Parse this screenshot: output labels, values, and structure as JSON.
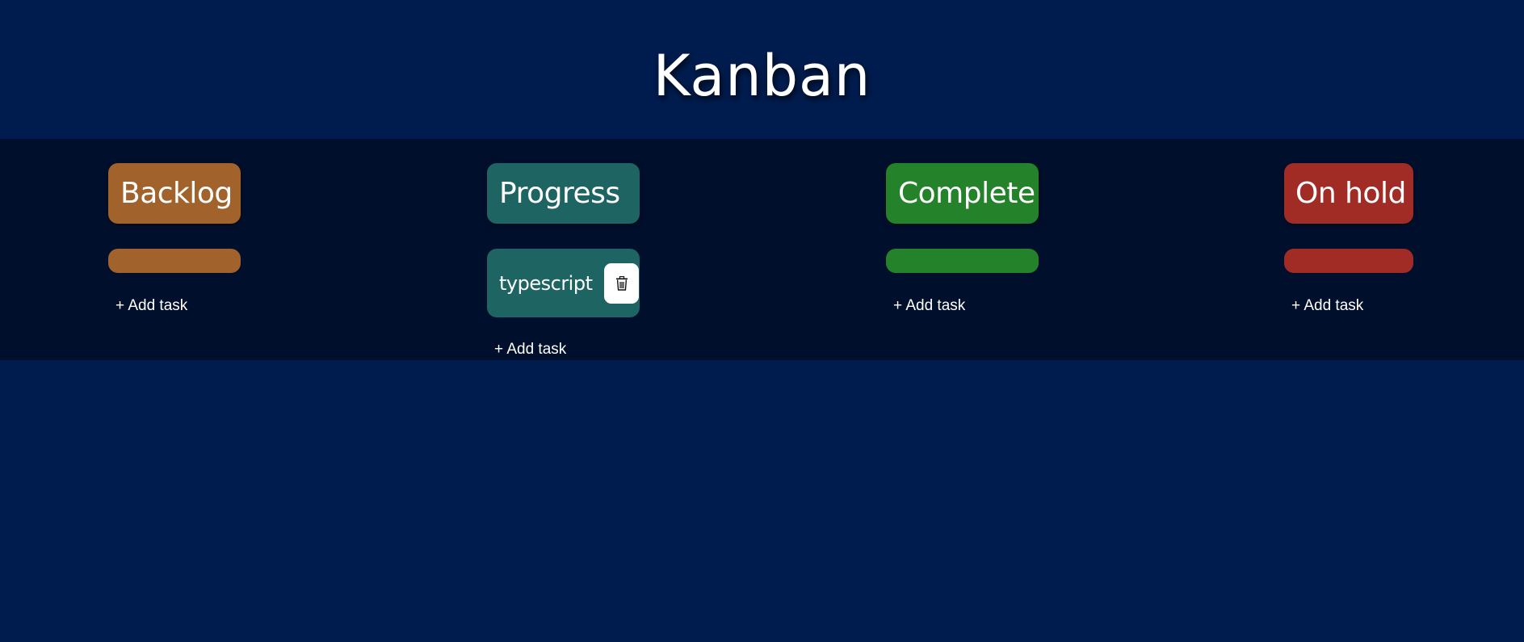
{
  "app": {
    "title": "Kanban"
  },
  "colors": {
    "page_background": "#001c4e",
    "board_background": "#000f2c",
    "backlog": "#a2622c",
    "progress": "#1d6462",
    "complete": "#24822a",
    "on_hold": "#a12c26"
  },
  "columns": [
    {
      "name": "Backlog",
      "color": "#a2622c",
      "tasks": [],
      "add_label": "+ Add task"
    },
    {
      "name": "Progress",
      "color": "#1d6462",
      "tasks": [
        {
          "text": "typescript",
          "delete_icon": "trash-icon"
        }
      ],
      "add_label": "+ Add task"
    },
    {
      "name": "Complete",
      "color": "#24822a",
      "tasks": [],
      "add_label": "+ Add task"
    },
    {
      "name": "On hold",
      "color": "#a12c26",
      "tasks": [],
      "add_label": "+ Add task"
    }
  ]
}
